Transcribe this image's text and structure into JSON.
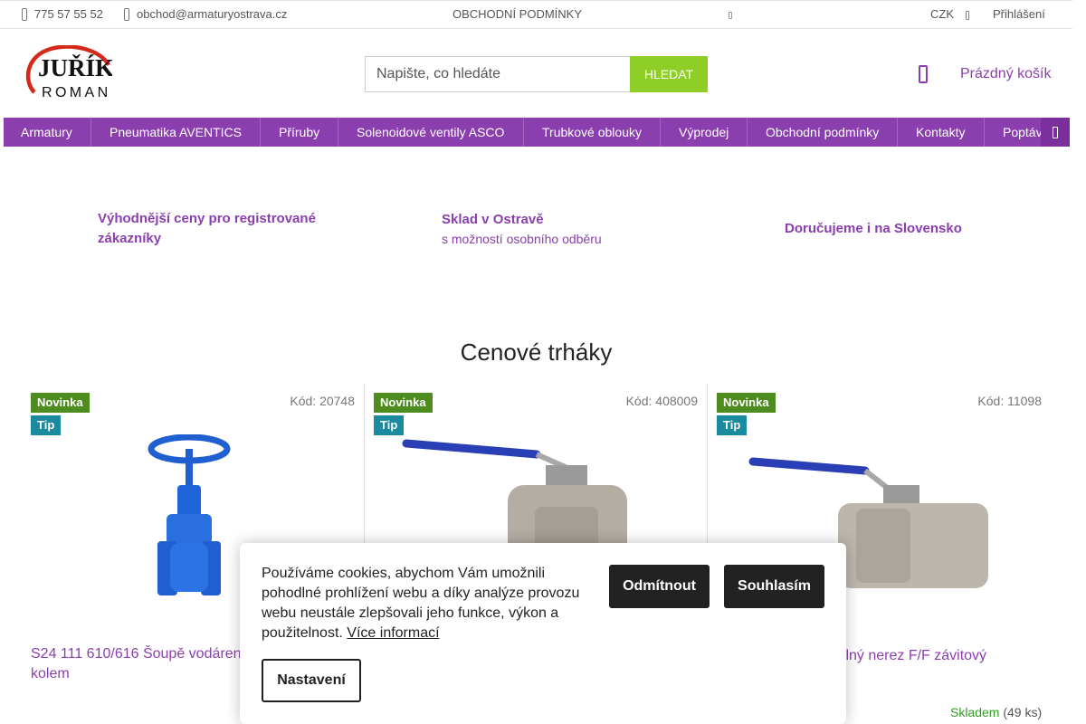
{
  "topbar": {
    "phone": "775 57 55 52",
    "email": "obchod@armaturyostrava.cz",
    "terms": "OBCHODNÍ PODMÍNKY",
    "currency": "CZK",
    "login": "Přihlášení"
  },
  "header": {
    "logo_top": "JUŘÍK",
    "logo_bottom": "ROMAN",
    "search_placeholder": "Napište, co hledáte",
    "search_button": "HLEDAT",
    "cart_label": "Prázdný košík"
  },
  "nav": {
    "items": [
      "Armatury",
      "Pneumatika AVENTICS",
      "Příruby",
      "Solenoidové ventily ASCO",
      "Trubkové oblouky",
      "Výprodej",
      "Obchodní podmínky",
      "Kontakty",
      "Poptáv"
    ]
  },
  "benefits": {
    "b1_line1": "Výhodnější ceny pro registrované",
    "b1_line2": "zákazníky",
    "b2_title": "Sklad v Ostravě",
    "b2_sub": "s možností osobního odběru",
    "b3_title": "Doručujeme i na Slovensko"
  },
  "section": {
    "title": "Cenové trháky"
  },
  "products": [
    {
      "flag_new": "Novinka",
      "flag_tip": "Tip",
      "code": "Kód: 20748",
      "name_line1": "S24 111 610/616 Šoupě vodáren",
      "name_line2": "kolem"
    },
    {
      "flag_new": "Novinka",
      "flag_tip": "Tip",
      "code": "Kód: 408009"
    },
    {
      "flag_new": "Novinka",
      "flag_tip": "Tip",
      "code": "Kód: 11098",
      "name_line1": "ílný nerez F/F závitový",
      "stock": "Skladem",
      "stock_count": "(49 ks)"
    }
  ],
  "cookie": {
    "text": "Používáme cookies, abychom Vám umožnili pohodlné prohlížení webu a díky analýze provozu webu neustále zlepšovali jeho funkce, výkon a použitelnost.",
    "more_link": "Více informací",
    "decline": "Odmítnout",
    "accept": "Souhlasím",
    "settings": "Nastavení"
  },
  "colors": {
    "brand_purple": "#8b3fae",
    "search_green": "#8fce26",
    "flag_new": "#4e8c20",
    "flag_tip": "#1a8a9e",
    "stock_green": "#2f9e1f",
    "logo_red": "#d42a1c"
  }
}
